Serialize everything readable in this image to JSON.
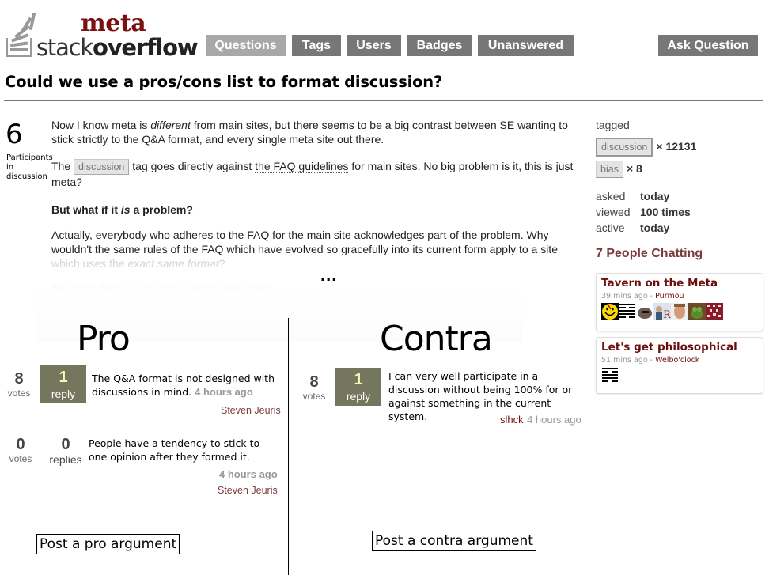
{
  "header": {
    "logo": {
      "meta": "meta",
      "stack": "stack",
      "overflow": "overflow"
    },
    "nav": [
      {
        "label": "Questions",
        "active": true
      },
      {
        "label": "Tags",
        "active": false
      },
      {
        "label": "Users",
        "active": false
      },
      {
        "label": "Badges",
        "active": false
      },
      {
        "label": "Unanswered",
        "active": false
      }
    ],
    "ask_question": "Ask Question"
  },
  "question": {
    "title": "Could we use a pros/cons list to format discussion?",
    "participants": {
      "count": "6",
      "label": "Participants in discussion"
    },
    "body": {
      "p1_a": "Now I know meta is ",
      "p1_em": "different",
      "p1_b": " from main sites, but there seems to be a big contrast between SE wanting to stick strictly to the Q&A format, and every single meta site out there.",
      "p2_a": "The ",
      "p2_tag": "discussion",
      "p2_b": " tag goes directly against ",
      "p2_link": "the FAQ guidelines",
      "p2_c": " for main sites. No big problem is it, this is just meta?",
      "p3_a": "But what if it ",
      "p3_em": "is",
      "p3_b": " a problem?",
      "p4_a": "Actually, everybody who adheres to the FAQ for the main site acknowledges part of the problem. Why wouldn't the same rules of the FAQ which have evolved so gracefully into its current form apply to a site ",
      "p4_b": "which uses the ",
      "p4_em": "exact same format",
      "p4_c": "?",
      "p5": "Because there is no other solution available?",
      "ellipsis": "..."
    }
  },
  "sidebar": {
    "tagged_label": "tagged",
    "tags": [
      {
        "name": "discussion",
        "count": "× 12131"
      },
      {
        "name": "bias",
        "count": "× 8"
      }
    ],
    "stats": [
      {
        "key": "asked",
        "value": "today"
      },
      {
        "key": "viewed",
        "value": "100 times"
      },
      {
        "key": "active",
        "value": "today"
      }
    ],
    "chatting_heading": "7 People Chatting",
    "chat_rooms": [
      {
        "name": "Tavern on the Meta",
        "time": "39 mins ago",
        "sep": " - ",
        "user": "Purmou",
        "avatars": [
          "smiley-avatar",
          "hexagram-avatar",
          "sunglasses-avatar",
          "rx-avatar",
          "face-avatar",
          "kermit-avatar",
          "pattern-avatar"
        ]
      },
      {
        "name": "Let's get philosophical",
        "time": "51 mins ago",
        "sep": " - ",
        "user": "Welbo'clock",
        "avatars": [
          "hexagram-avatar"
        ]
      }
    ]
  },
  "pro": {
    "heading": "Pro",
    "arguments": [
      {
        "votes": "8",
        "votes_label": "votes",
        "replies": "1",
        "replies_label": "reply",
        "text": "The Q&A format is not designed with discussions in mind.",
        "time": "4 hours ago",
        "author": "Steven Jeuris"
      },
      {
        "votes": "0",
        "votes_label": "votes",
        "replies": "0",
        "replies_label": "replies",
        "text": "People have a tendency to stick to one opinion after they formed it.",
        "time": "4 hours ago",
        "author": "Steven Jeuris"
      }
    ],
    "post_button": "Post a pro argument"
  },
  "contra": {
    "heading": "Contra",
    "arguments": [
      {
        "votes": "8",
        "votes_label": "votes",
        "replies": "1",
        "replies_label": "reply",
        "text": "I can very well participate in a discussion without being 100% for or against something in the current system.",
        "time": "4 hours ago",
        "author": "slhck"
      }
    ],
    "post_button": "Post a contra argument"
  }
}
